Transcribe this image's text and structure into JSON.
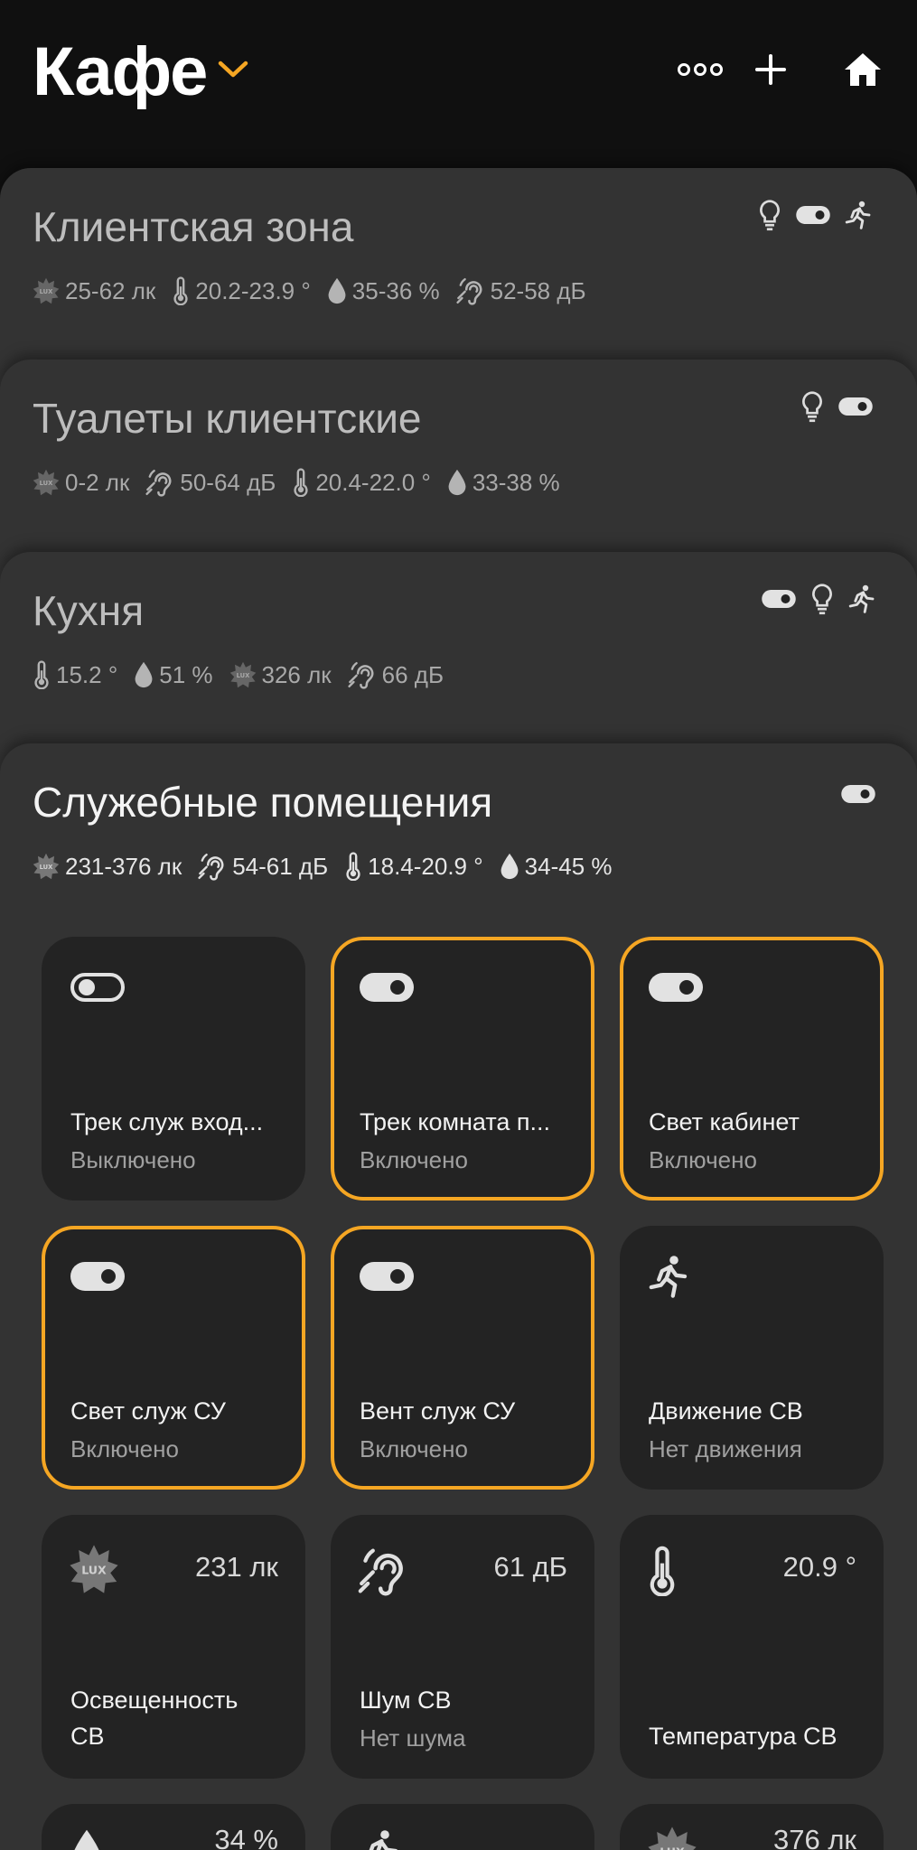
{
  "header": {
    "title": "Кафе",
    "accent_color": "#f5a623",
    "actions": [
      "more-dots-icon",
      "plus-icon",
      "home-icon"
    ]
  },
  "rooms": [
    {
      "name": "Клиентская зона",
      "metrics": {
        "lux": "25-62 лк",
        "temp": "20.2-23.9 °",
        "humidity": "35-36 %",
        "noise": "52-58 дБ"
      },
      "status_icons": [
        "bulb-icon",
        "switch-icon",
        "motion-icon"
      ]
    },
    {
      "name": "Туалеты клиентские",
      "metrics": {
        "lux": "0-2 лк",
        "noise": "50-64 дБ",
        "temp": "20.4-22.0 °",
        "humidity": "33-38 %"
      },
      "status_icons": [
        "bulb-icon",
        "switch-icon"
      ]
    },
    {
      "name": "Кухня",
      "metrics": {
        "temp": "15.2 °",
        "humidity": "51 %",
        "lux": "326 лк",
        "noise": "66 дБ"
      },
      "status_icons": [
        "switch-icon",
        "bulb-icon",
        "motion-icon"
      ]
    },
    {
      "name": "Служебные помещения",
      "metrics": {
        "lux": "231-376 лк",
        "noise": "54-61 дБ",
        "temp": "18.4-20.9 °",
        "humidity": "34-45 %"
      },
      "status_icons": [
        "switch-icon"
      ]
    }
  ],
  "tiles": [
    {
      "name": "Трек служ вход...",
      "state": "Выключено",
      "icon": "switch-off-icon",
      "on": false
    },
    {
      "name": "Трек комната п...",
      "state": "Включено",
      "icon": "switch-on-icon",
      "on": true
    },
    {
      "name": "Свет кабинет",
      "state": "Включено",
      "icon": "switch-on-icon",
      "on": true
    },
    {
      "name": "Свет служ СУ",
      "state": "Включено",
      "icon": "switch-on-icon",
      "on": true
    },
    {
      "name": "Вент служ СУ",
      "state": "Включено",
      "icon": "switch-on-icon",
      "on": true
    },
    {
      "name": "Движение СВ",
      "state": "Нет движения",
      "icon": "motion-icon",
      "on": false
    },
    {
      "name": "Освещенность",
      "name2": "СВ",
      "value": "231 лк",
      "icon": "lux-icon",
      "on": false
    },
    {
      "name": "Шум СВ",
      "state": "Нет шума",
      "value": "61 дБ",
      "icon": "ear-icon",
      "on": false
    },
    {
      "name": "Температура СВ",
      "value": "20.9 °",
      "icon": "thermometer-icon",
      "on": false
    },
    {
      "value": "34 %",
      "icon": "droplet-icon"
    },
    {
      "value": "",
      "icon": "motion-icon"
    },
    {
      "value": "376 лк",
      "icon": "lux-icon"
    }
  ]
}
